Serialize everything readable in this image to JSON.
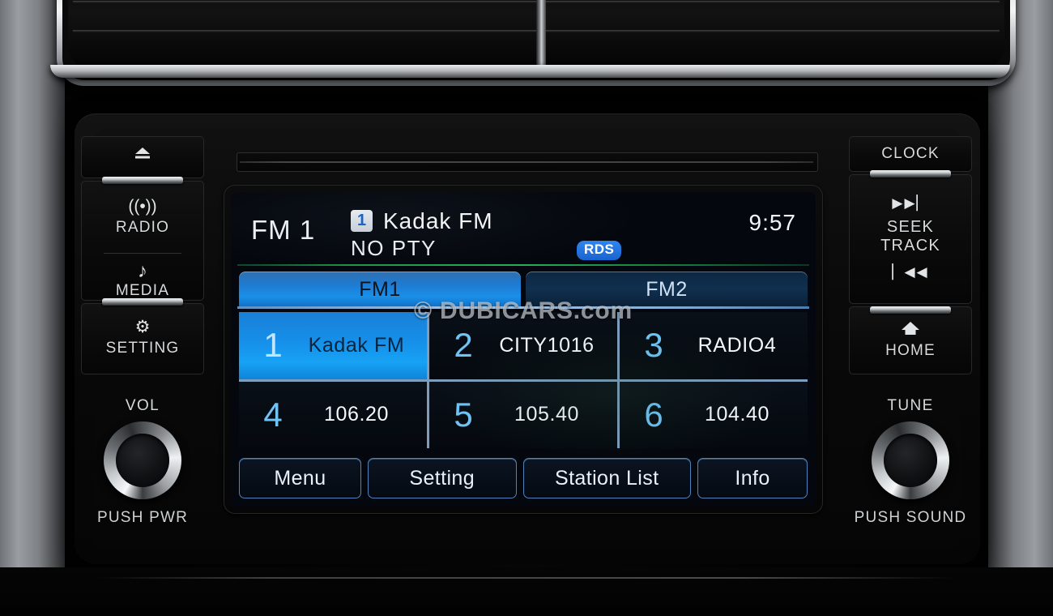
{
  "device": {
    "name": "car-audio-head-unit"
  },
  "left_keys": {
    "eject": {
      "label": "",
      "icon": "eject-icon"
    },
    "radio": {
      "label": "RADIO",
      "icon": "radio-wave-icon"
    },
    "media": {
      "label": "MEDIA",
      "icon": "music-note-icon"
    },
    "setting": {
      "label": "SETTING",
      "icon": "gear-icon"
    },
    "volume": {
      "cap_label": "VOL",
      "sub_label": "PUSH PWR",
      "icon": "rotary-knob"
    }
  },
  "right_keys": {
    "clock": {
      "label": "CLOCK"
    },
    "seek": {
      "top_glyph": "▶▶▏",
      "bottom_glyph": "▏◀◀",
      "line1": "SEEK",
      "line2": "TRACK"
    },
    "home": {
      "label": "HOME",
      "icon": "home-icon"
    },
    "tune": {
      "cap_label": "TUNE",
      "sub_label": "PUSH SOUND",
      "icon": "rotary-knob"
    }
  },
  "screen": {
    "header": {
      "band": "FM 1",
      "preset_number": "1",
      "station_name": "Kadak  FM",
      "pty": "NO  PTY",
      "rds_badge": "RDS",
      "clock": "9:57"
    },
    "tabs": [
      {
        "label": "FM1",
        "active": true
      },
      {
        "label": "FM2",
        "active": false
      }
    ],
    "presets": [
      {
        "number": "1",
        "text": "Kadak  FM",
        "selected": true
      },
      {
        "number": "2",
        "text": "CITY1016",
        "selected": false
      },
      {
        "number": "3",
        "text": "RADIO4",
        "selected": false
      },
      {
        "number": "4",
        "text": "106.20",
        "selected": false
      },
      {
        "number": "5",
        "text": "105.40",
        "selected": false
      },
      {
        "number": "6",
        "text": "104.40",
        "selected": false
      }
    ],
    "soft_buttons": [
      {
        "label": "Menu"
      },
      {
        "label": "Setting"
      },
      {
        "label": "Station List"
      },
      {
        "label": "Info"
      }
    ],
    "watermark": "© DUBICARS.com"
  },
  "colors": {
    "accent_blue": "#17a2f4",
    "tab_active_blue": "#1a8fe8",
    "preset_number_blue": "#6fc3f5",
    "rds_blue": "#1a63d0",
    "green_rule": "#29b45d",
    "screen_bg": "#04070d"
  }
}
